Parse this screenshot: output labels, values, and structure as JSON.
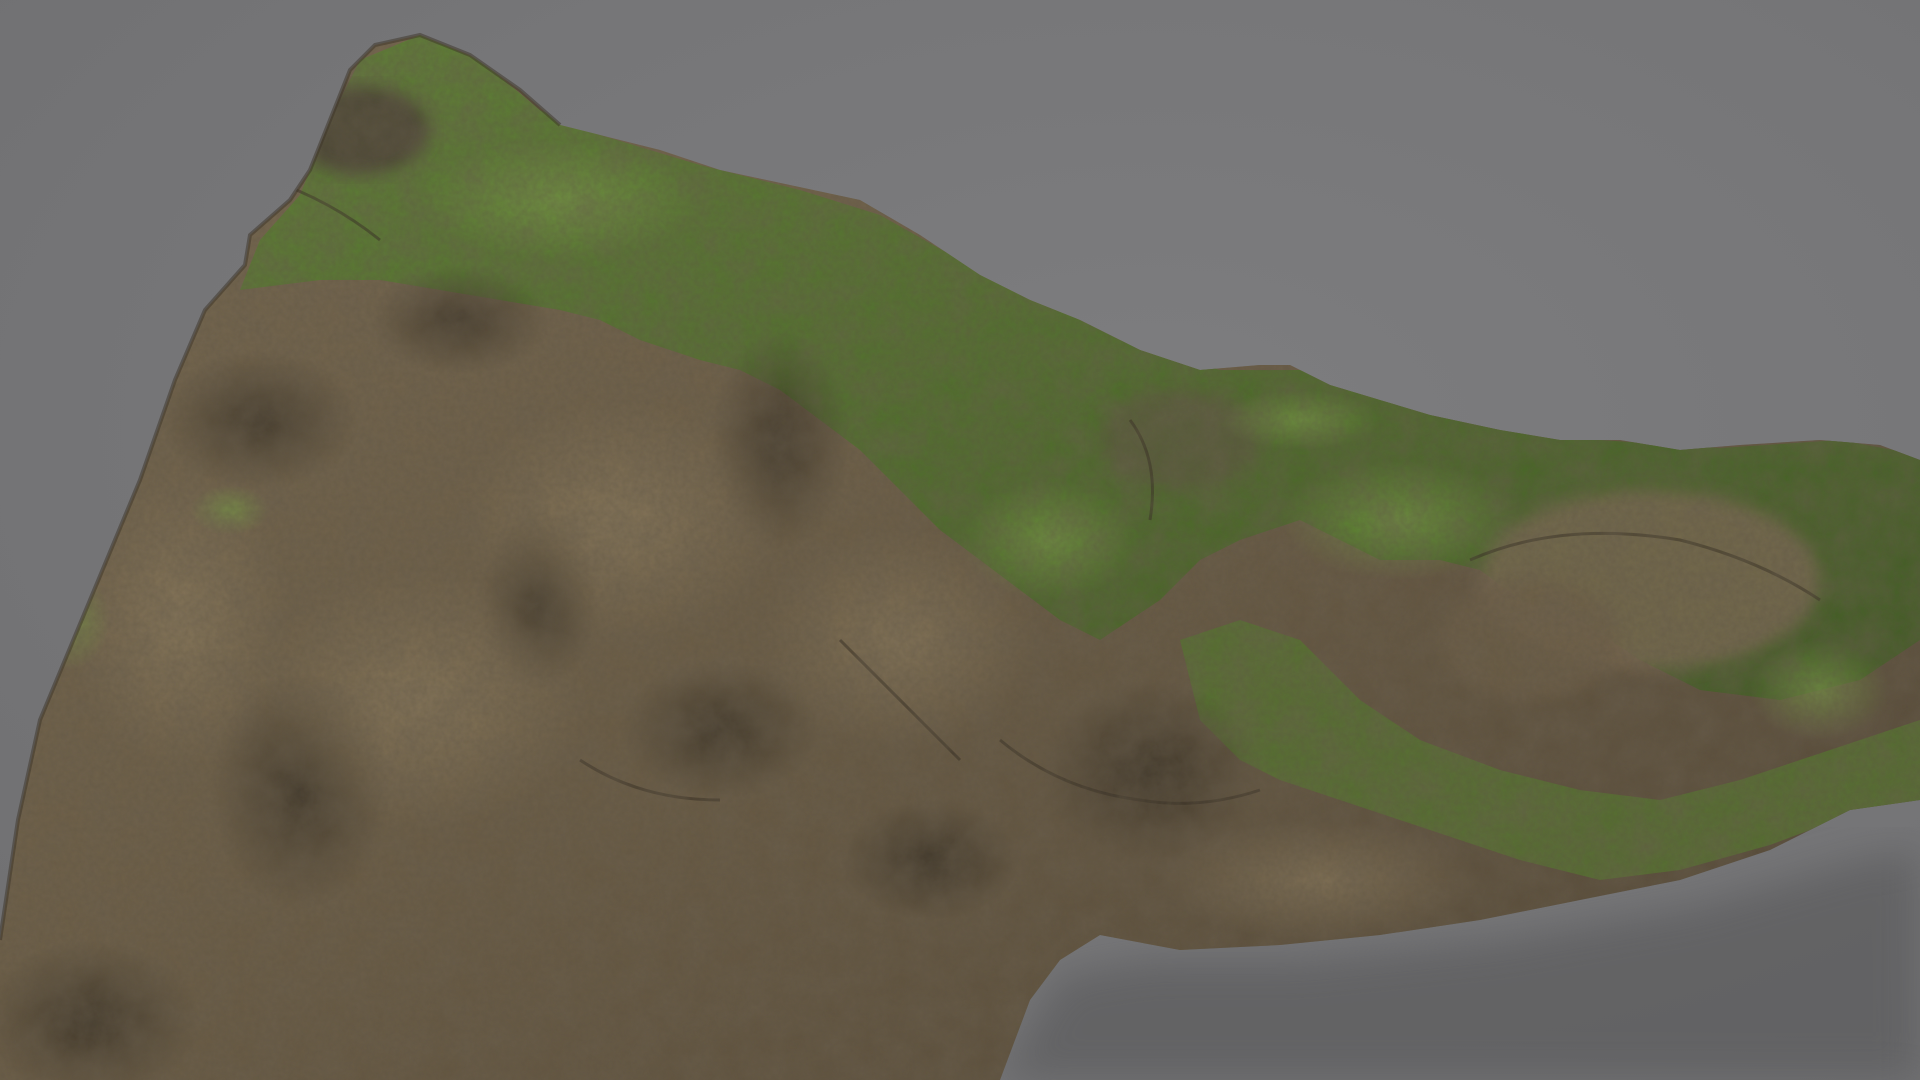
{
  "scene": {
    "background_color": "#777779",
    "subject": "moss-covered-rock",
    "colors": {
      "rock_light": "#8a7a5e",
      "rock_mid": "#6b5c45",
      "rock_dark": "#3a3226",
      "moss_light": "#6f9a3a",
      "moss_mid": "#4f7429",
      "moss_dark": "#2f4a1c",
      "shadow": "#5f5f61"
    }
  }
}
